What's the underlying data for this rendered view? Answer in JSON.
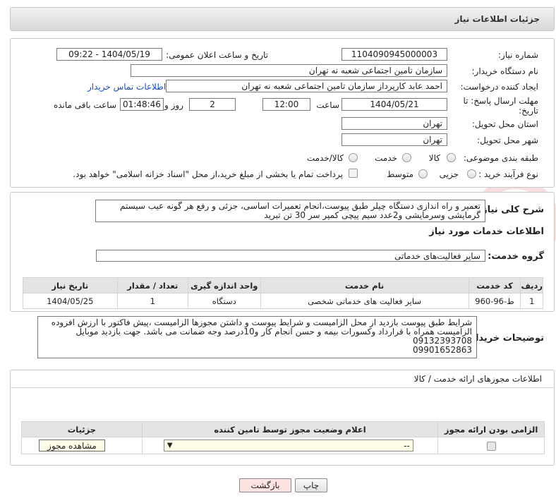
{
  "title": "جزئیات اطلاعات نیاز",
  "fields": {
    "need_number_label": "شماره نیاز:",
    "need_number": "1104090945000003",
    "announce_label": "تاریخ و ساعت اعلان عمومی:",
    "announce_value": "1404/05/19 - 09:22",
    "buyer_org_label": "نام دستگاه خریدار:",
    "buyer_org": "سازمان تامین اجتماعی شعبه نه تهران",
    "creator_label": "ایجاد کننده درخواست:",
    "creator": "احمد عابد کارپرداز سازمان تامین اجتماعی شعبه نه تهران",
    "contact_link": "اطلاعات تماس خریدار",
    "deadline_label_1": "مهلت ارسال پاسخ: تا",
    "deadline_label_2": "تاریخ:",
    "deadline_date": "1404/05/21",
    "time_label": "ساعت",
    "deadline_time": "12:00",
    "days_value": "2",
    "days_label": "روز و",
    "remaining_time": "01:48:46",
    "remaining_label": "ساعت باقی مانده",
    "province_label": "استان محل تحویل:",
    "province": "تهران",
    "city_label": "شهر محل تحویل:",
    "city": "تهران",
    "category_label": "طبقه بندی موضوعی:",
    "category_options": [
      "کالا",
      "خدمت",
      "کالا/خدمت"
    ],
    "process_label": "نوع فرآیند خرید :",
    "process_options": [
      "جزیی",
      "متوسط"
    ],
    "payment_note": "پرداخت تمام یا بخشی از مبلغ خرید،از محل \"اسناد خزانه اسلامی\" خواهد بود."
  },
  "summary": {
    "label": "شرح کلی نیاز:",
    "text": "تعمیر  و راه اندازی دستگاه چیلر طبق پیوست،انجام تعمیرات اساسی، جزئی و رفع هر گونه عیب سیستم گرمایشی وسرمایشی و2عدد سیم پیچی کمپر سر 30 تن تبرید"
  },
  "services": {
    "heading": "اطلاعات خدمات مورد نیاز",
    "group_label": "گروه خدمت:",
    "group_value": "سایر فعالیت‌های خدماتی",
    "columns": [
      "ردیف",
      "کد خدمت",
      "نام خدمت",
      "واحد اندازه گیری",
      "تعداد / مقدار",
      "تاریخ نیاز"
    ],
    "rows": [
      [
        "1",
        "ط-96-960",
        "سایر فعالیت های خدماتی شخصی",
        "دستگاه",
        "1",
        "1404/05/25"
      ]
    ]
  },
  "buyer_notes": {
    "label": "توضیحات خریدار:",
    "lines": [
      "شرایط طبق پیوست بازدید از محل الزامیست  و شرایط پیوست و داشتن مجوزها الزامیست ،پیش فاکتور  با ارزش افزوده",
      "الزامیست همراه با قرارداد وکسورات بیمه و حسن انجام کار و10درصد وجه ضمانت می باشد. جهت بازدید موبایل",
      "09132393708",
      "09901652863"
    ]
  },
  "permits": {
    "heading": "اطلاعات مجوزهای ارائه خدمت / کالا",
    "columns": [
      "الزامی بودن ارائه مجوز",
      "اعلام وضعیت مجوز توسط تامین کننده",
      "جزئیات"
    ],
    "select_value": "--",
    "view_button": "مشاهده مجوز"
  },
  "footer": {
    "print_button": "چاپ",
    "back_button": "بازگشت"
  },
  "colors": {
    "link": "#1a4fc4",
    "back_bg": "#fde2e2",
    "header_bg": "#e4e4e4"
  }
}
